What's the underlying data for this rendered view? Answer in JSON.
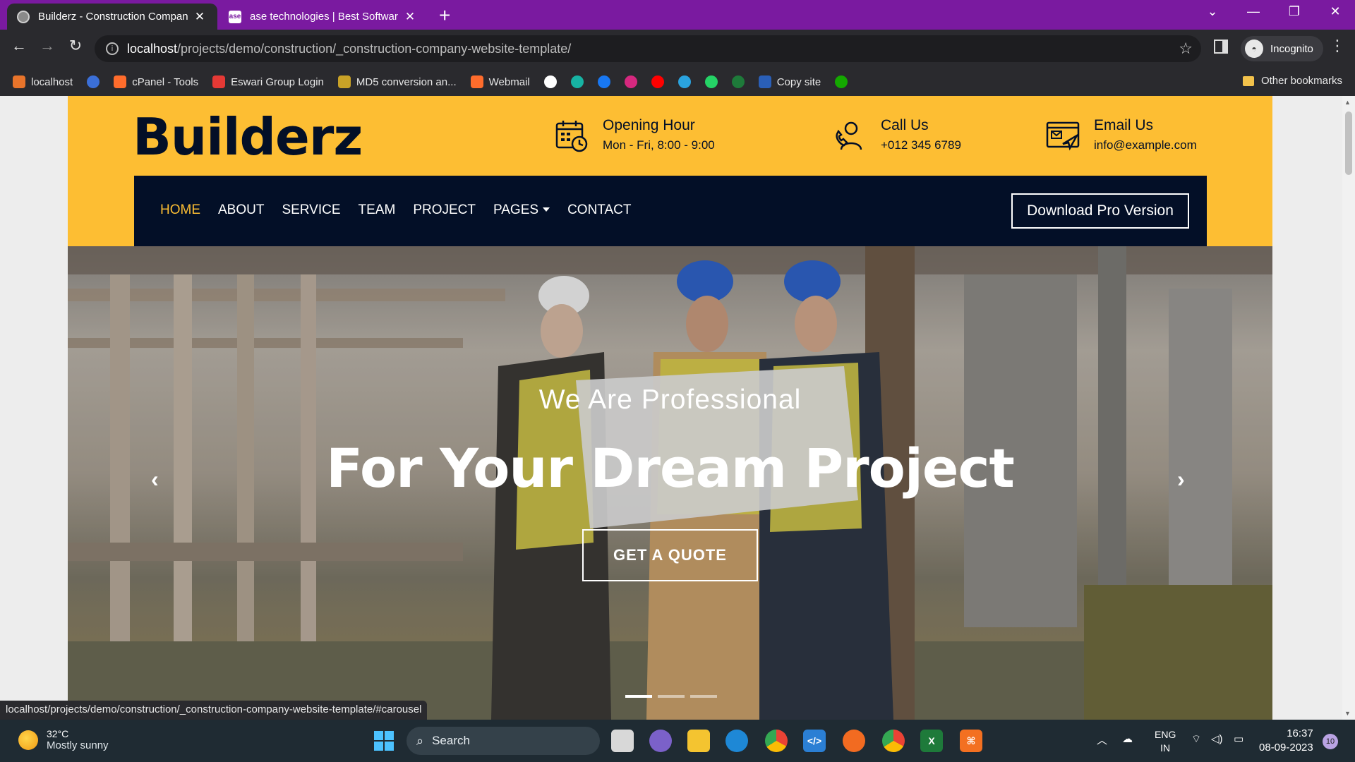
{
  "browser": {
    "tabs": [
      {
        "title": "Builderz - Construction Company",
        "active": true
      },
      {
        "title": "ase technologies | Best Software",
        "active": false
      }
    ],
    "favicon_ase": "ase",
    "url_host": "localhost",
    "url_path": "/projects/demo/construction/_construction-company-website-template/",
    "profile_label": "Incognito",
    "bookmarks": [
      {
        "label": "localhost",
        "icon": "xampp-icon",
        "color": "#e8742b"
      },
      {
        "label": "",
        "icon": "f-icon",
        "color": "#3b6fd8"
      },
      {
        "label": "cPanel - Tools",
        "icon": "cpanel-icon",
        "color": "#ff6c2c"
      },
      {
        "label": "Eswari Group Login",
        "icon": "g-icon",
        "color": "#e53935"
      },
      {
        "label": "MD5 conversion an...",
        "icon": "key-icon",
        "color": "#c9a227"
      },
      {
        "label": "Webmail",
        "icon": "cpanel-icon",
        "color": "#ff6c2c"
      },
      {
        "label": "",
        "icon": "github-icon",
        "color": "#ffffff"
      },
      {
        "label": "",
        "icon": "diamond-icon",
        "color": "#17b3a3"
      },
      {
        "label": "",
        "icon": "facebook-icon",
        "color": "#1877f2"
      },
      {
        "label": "",
        "icon": "instagram-icon",
        "color": "#d6287f"
      },
      {
        "label": "",
        "icon": "youtube-icon",
        "color": "#ff0000"
      },
      {
        "label": "",
        "icon": "telegram-icon",
        "color": "#2aa3df"
      },
      {
        "label": "",
        "icon": "whatsapp-icon",
        "color": "#25d366"
      },
      {
        "label": "",
        "icon": "sheet-icon",
        "color": "#1e7a3a"
      },
      {
        "label": "Copy site",
        "icon": "w-icon",
        "color": "#2a5fb8"
      },
      {
        "label": "",
        "icon": "upwork-icon",
        "color": "#14a800"
      }
    ],
    "other_bookmarks": "Other bookmarks",
    "status_url": "localhost/projects/demo/construction/_construction-company-website-template/#carousel"
  },
  "site": {
    "logo": "Builderz",
    "opening": {
      "title": "Opening Hour",
      "value": "Mon - Fri, 8:00 - 9:00"
    },
    "call": {
      "title": "Call Us",
      "value": "+012 345 6789"
    },
    "email": {
      "title": "Email Us",
      "value": "info@example.com"
    },
    "nav": [
      "HOME",
      "ABOUT",
      "SERVICE",
      "TEAM",
      "PROJECT",
      "PAGES",
      "CONTACT"
    ],
    "nav_active": "HOME",
    "pro_button": "Download Pro Version",
    "hero": {
      "subtitle": "We Are Professional",
      "title": "For Your Dream Project",
      "button": "GET A QUOTE",
      "slides": 3,
      "active_slide": 1
    },
    "colors": {
      "primary": "#fdbe33",
      "dark": "#030f27"
    }
  },
  "taskbar": {
    "temperature": "32°C",
    "weather": "Mostly sunny",
    "search": "Search",
    "lang1": "ENG",
    "lang2": "IN",
    "time": "16:37",
    "date": "08-09-2023",
    "notifications": "10"
  }
}
